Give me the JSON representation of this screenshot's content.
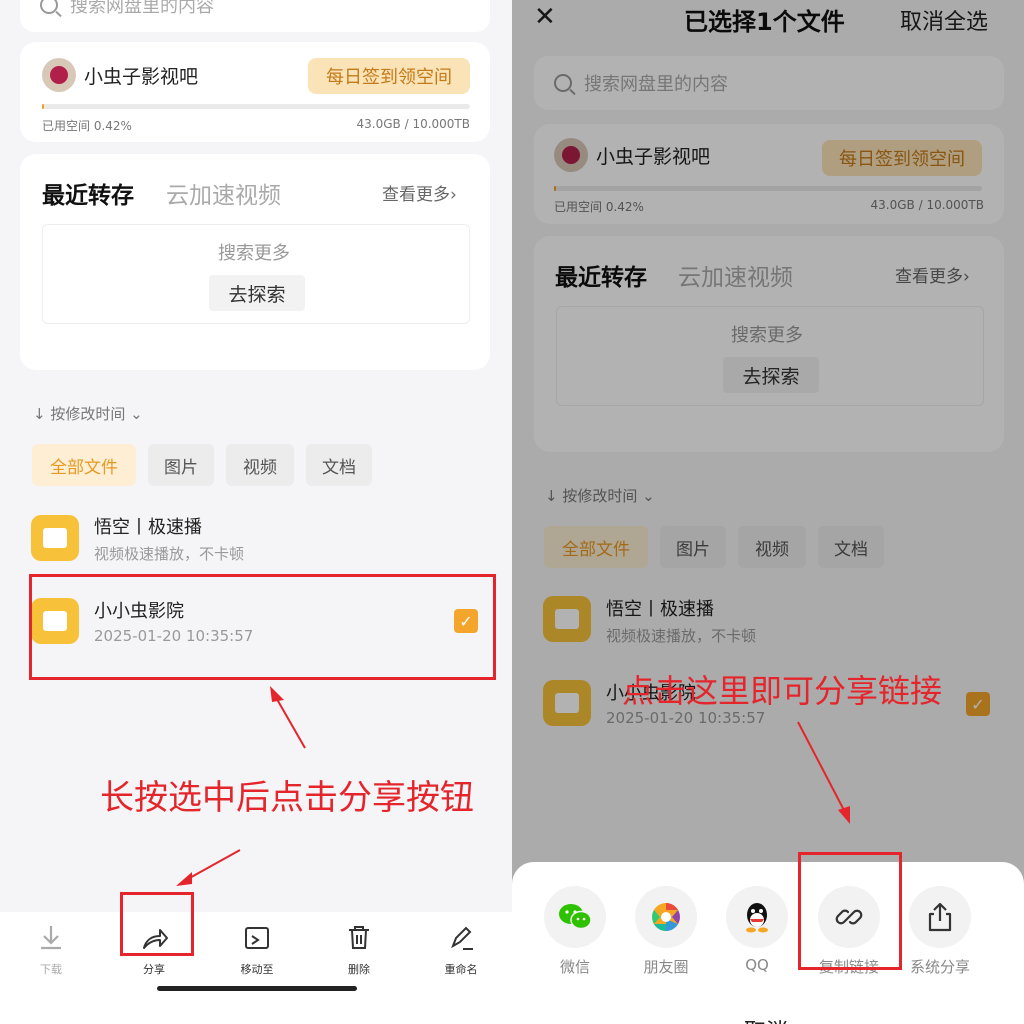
{
  "colors": {
    "accent": "#f3a52c",
    "annotation": "#e4252b",
    "signbg": "#fbe3b8"
  },
  "search": {
    "placeholder": "搜索网盘里的内容"
  },
  "user": {
    "name": "小虫子影视吧",
    "sign_button": "每日签到领空间",
    "used_label": "已用空间 0.42%",
    "capacity": "43.0GB / 10.000TB",
    "used_fraction": 0.0042
  },
  "recent": {
    "tab_active": "最近转存",
    "tab_inactive": "云加速视频",
    "more": "查看更多",
    "more_arrow": "›",
    "empty_hint": "搜索更多",
    "explore_button": "去探索"
  },
  "sort": {
    "label": "按修改时间",
    "arrow_down": "↓",
    "chevron": "⌄"
  },
  "filters": [
    "全部文件",
    "图片",
    "视频",
    "文档"
  ],
  "files": [
    {
      "name": "悟空丨极速播",
      "sub": "视频极速播放，不卡顿",
      "icon": "folder-icon"
    },
    {
      "name": "小小虫影院",
      "sub": "2025-01-20 10:35:57",
      "icon": "folder-icon",
      "selected": true
    }
  ],
  "check_mark": "✓",
  "toolbar": {
    "download": "下载",
    "share": "分享",
    "move": "移动至",
    "delete": "删除",
    "rename": "重命名"
  },
  "annotations": {
    "left": "长按选中后点击分享按钮",
    "right": "点击这里即可分享链接"
  },
  "selection": {
    "close": "✕",
    "title": "已选择1个文件",
    "cancel_all": "取消全选"
  },
  "share_sheet": {
    "wechat": "微信",
    "moments": "朋友圈",
    "qq": "QQ",
    "copy_link": "复制链接",
    "system_share": "系统分享",
    "cancel": "取消"
  }
}
